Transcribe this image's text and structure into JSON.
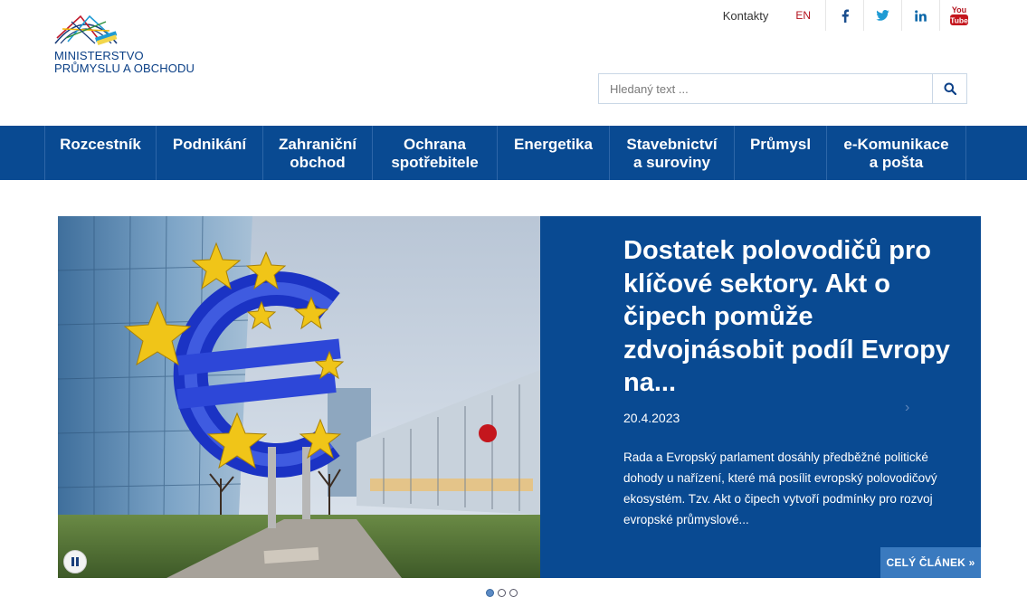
{
  "header": {
    "logo_line1": "MINISTERSTVO",
    "logo_line2": "PRŮMYSLU A OBCHODU",
    "contacts": "Kontakty",
    "language": "EN",
    "social": [
      "facebook-icon",
      "twitter-icon",
      "linkedin-icon",
      "youtube-icon"
    ],
    "youtube_label_1": "You",
    "youtube_label_2": "Tube"
  },
  "search": {
    "placeholder": "Hledaný text ..."
  },
  "nav": [
    "Rozcestník",
    "Podnikání",
    "Zahraniční obchod",
    "Ochrana spotřebitele",
    "Energetika",
    "Stavebnictví a suroviny",
    "Průmysl",
    "e-Komunikace a pošta"
  ],
  "slide": {
    "headline": "Dostatek polovodičů pro klíčové sektory. Akt o čipech pomůže zdvojnásobit podíl Evropy na...",
    "date": "20.4.2023",
    "excerpt": "Rada a Evropský parlament dosáhly předběžné politické dohody u nařízení, které má posílit evropský polovodičový ekosystém. Tzv. Akt o čipech vytvoří podmínky pro rozvoj evropské průmyslové...",
    "read_more": "CELÝ ČLÁNEK »",
    "next_arrow": "›"
  },
  "colors": {
    "brand_blue": "#094a92",
    "accent_red": "#b4121d",
    "button_blue": "#3a7abf"
  }
}
